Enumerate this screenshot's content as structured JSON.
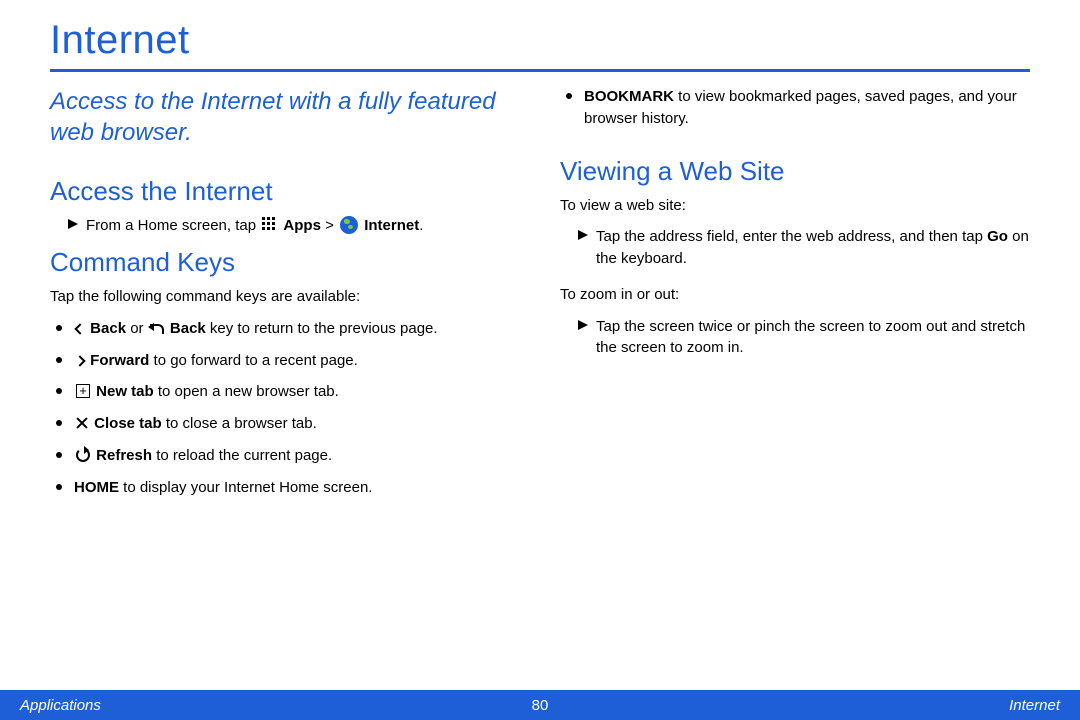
{
  "title": "Internet",
  "intro": "Access to the Internet with a fully featured web browser.",
  "sections": {
    "access": {
      "heading": "Access the Internet",
      "step_prefix": "From a Home screen, tap ",
      "apps_label": "Apps",
      "gt": " > ",
      "internet_label": "Internet",
      "period": "."
    },
    "command": {
      "heading": "Command Keys",
      "intro": "Tap the following command keys are available:",
      "items": {
        "back": {
          "label": "Back",
          "or": " or ",
          "label2": "Back",
          "rest": " key to return to the previous page."
        },
        "forward": {
          "label": "Forward",
          "rest": " to go forward to a recent page."
        },
        "newtab": {
          "label": "New tab",
          "rest": " to open a new browser tab."
        },
        "closetab": {
          "label": "Close tab",
          "rest": " to close a browser tab."
        },
        "refresh": {
          "label": "Refresh",
          "rest": " to reload the current page."
        },
        "home": {
          "label": "HOME",
          "rest": " to display your Internet Home screen."
        },
        "bookmark": {
          "label": "BOOKMARK",
          "rest": " to view bookmarked pages, saved pages, and your browser history."
        }
      }
    },
    "viewing": {
      "heading": "Viewing a Web Site",
      "p1": "To view a web site:",
      "step1a": "Tap the address field, enter the web address, and then tap ",
      "step1_go": "Go",
      "step1b": " on the keyboard.",
      "p2": "To zoom in or out:",
      "step2": "Tap the screen twice or pinch the screen to zoom out and stretch the screen to zoom in."
    }
  },
  "footer": {
    "left": "Applications",
    "center": "80",
    "right": "Internet"
  }
}
